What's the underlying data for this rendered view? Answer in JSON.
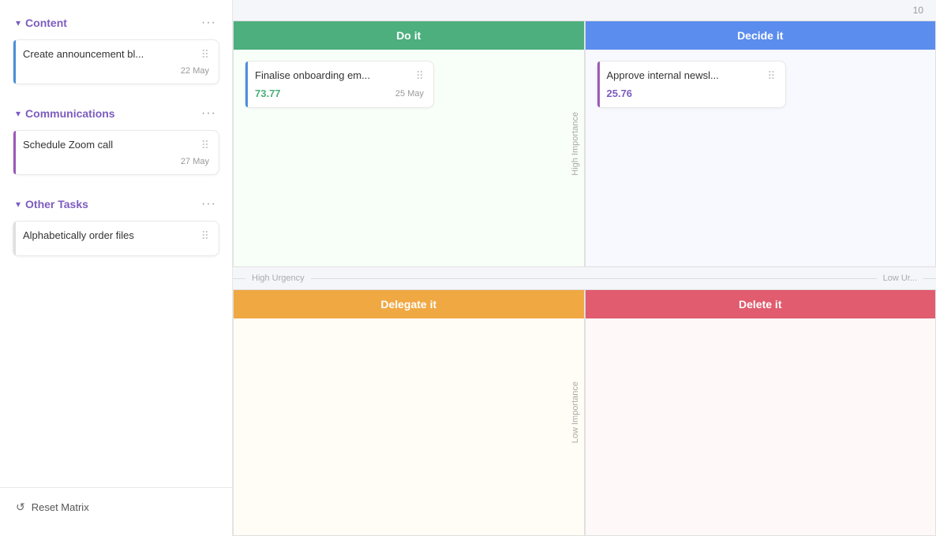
{
  "sidebar": {
    "sections": [
      {
        "id": "content",
        "title": "Content",
        "color": "#7c5cbf",
        "tasks": [
          {
            "id": "task-1",
            "title": "Create announcement bl...",
            "date": "22 May",
            "border_color": "#4a90d9"
          }
        ]
      },
      {
        "id": "communications",
        "title": "Communications",
        "color": "#7c5cbf",
        "tasks": [
          {
            "id": "task-2",
            "title": "Schedule Zoom call",
            "date": "27 May",
            "border_color": "#9b59b6"
          }
        ]
      },
      {
        "id": "other-tasks",
        "title": "Other Tasks",
        "color": "#7c5cbf",
        "tasks": [
          {
            "id": "task-3",
            "title": "Alphabetically order files",
            "date": null,
            "border_color": "#e0e0e0"
          }
        ]
      }
    ],
    "footer": {
      "reset_label": "Reset Matrix"
    }
  },
  "matrix": {
    "number_indicator": "10",
    "quadrants": [
      {
        "id": "do-it",
        "label": "Do it",
        "position": "top-left",
        "header_color": "#4caf7d",
        "tasks": [
          {
            "title": "Finalise onboarding em...",
            "score": "73.77",
            "score_color": "#4caf7d",
            "date": "25 May",
            "border_color": "#4a90d9"
          }
        ]
      },
      {
        "id": "decide-it",
        "label": "Decide it",
        "position": "top-right",
        "header_color": "#5b8dee",
        "tasks": [
          {
            "title": "Approve internal newsl...",
            "score": "25.76",
            "score_color": "#7c5cbf",
            "date": null,
            "border_color": "#9b59b6"
          }
        ]
      },
      {
        "id": "delegate-it",
        "label": "Delegate it",
        "position": "bottom-left",
        "header_color": "#f0a843",
        "tasks": []
      },
      {
        "id": "delete-it",
        "label": "Delete it",
        "position": "bottom-right",
        "header_color": "#e05c6e",
        "tasks": []
      }
    ],
    "axis": {
      "high_urgency": "High Urgency",
      "low_urgency": "Low Ur...",
      "high_importance": "High Importance",
      "low_importance": "Low Importance"
    }
  }
}
